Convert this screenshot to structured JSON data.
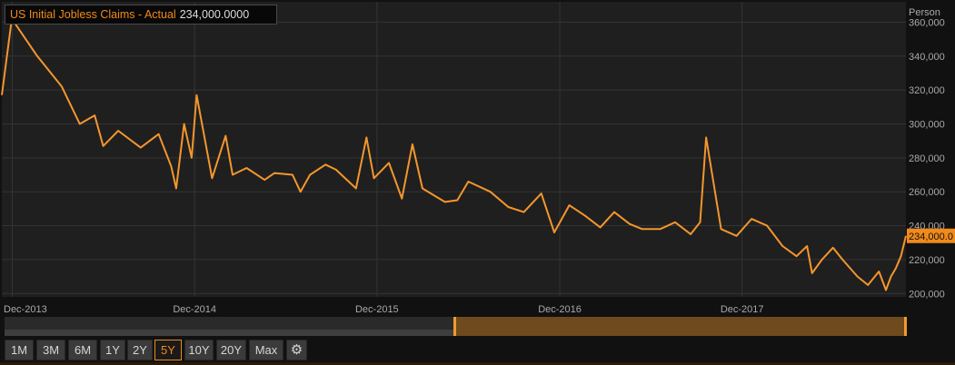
{
  "legend": {
    "series": "US Initial Jobless Claims - Actual",
    "value": "234,000.0000"
  },
  "unit": "Person",
  "colors": {
    "background": "#111111",
    "plot": "#1f1f1f",
    "grid": "#343434",
    "line": "#f4962d",
    "accent": "#f08a1c",
    "tick_text": "#a9a9a9"
  },
  "ranges": {
    "buttons": [
      "1M",
      "3M",
      "6M",
      "1Y",
      "2Y",
      "5Y",
      "10Y",
      "20Y",
      "Max"
    ],
    "active": "5Y",
    "settings_icon": "gear-icon"
  },
  "chart_data": {
    "type": "line",
    "title": "",
    "xlabel": "",
    "ylabel": "Person",
    "ylim": [
      198000,
      372000
    ],
    "xlim": [
      "2013-11-10",
      "2018-10-25"
    ],
    "x_ticks": [
      "Dec-2013",
      "Dec-2014",
      "Dec-2015",
      "Dec-2016",
      "Dec-2017"
    ],
    "x_tick_dates": [
      "2013-12-01",
      "2014-12-01",
      "2015-12-01",
      "2016-12-01",
      "2017-12-01"
    ],
    "y_ticks": [
      200000,
      220000,
      240000,
      260000,
      280000,
      300000,
      320000,
      340000,
      360000
    ],
    "y_tick_labels": [
      "200,000",
      "220,000",
      "240,000",
      "260,000",
      "280,000",
      "300,000",
      "320,000",
      "340,000",
      "360,000"
    ],
    "last_value_label": "234,000.0",
    "grid": true,
    "series": [
      {
        "name": "US Initial Jobless Claims - Actual",
        "x": [
          "2013-11-10",
          "2013-11-30",
          "2014-01-20",
          "2014-03-10",
          "2014-04-15",
          "2014-05-15",
          "2014-06-01",
          "2014-07-01",
          "2014-08-15",
          "2014-09-20",
          "2014-10-15",
          "2014-10-25",
          "2014-11-10",
          "2014-11-25",
          "2014-12-05",
          "2015-01-05",
          "2015-02-01",
          "2015-02-15",
          "2015-03-15",
          "2015-04-20",
          "2015-05-10",
          "2015-06-15",
          "2015-07-01",
          "2015-07-20",
          "2015-08-20",
          "2015-09-10",
          "2015-10-20",
          "2015-11-10",
          "2015-11-25",
          "2015-12-25",
          "2016-01-20",
          "2016-02-10",
          "2016-03-01",
          "2016-04-15",
          "2016-05-10",
          "2016-06-01",
          "2016-07-15",
          "2016-08-20",
          "2016-09-20",
          "2016-10-25",
          "2016-11-20",
          "2016-12-20",
          "2017-01-20",
          "2017-02-20",
          "2017-03-20",
          "2017-04-20",
          "2017-05-15",
          "2017-06-20",
          "2017-07-20",
          "2017-08-20",
          "2017-09-08",
          "2017-09-20",
          "2017-10-20",
          "2017-11-20",
          "2017-12-20",
          "2018-01-20",
          "2018-02-20",
          "2018-03-20",
          "2018-04-10",
          "2018-04-20",
          "2018-05-10",
          "2018-06-01",
          "2018-06-20",
          "2018-07-20",
          "2018-08-10",
          "2018-09-01",
          "2018-09-15",
          "2018-09-25",
          "2018-10-05",
          "2018-10-15",
          "2018-10-25"
        ],
        "values": [
          317000,
          362000,
          340000,
          322000,
          300000,
          305000,
          287000,
          296000,
          286000,
          294000,
          275000,
          262000,
          300000,
          280000,
          317000,
          268000,
          293000,
          270000,
          274000,
          267000,
          271000,
          270000,
          260000,
          270000,
          276000,
          273000,
          262000,
          292000,
          268000,
          277000,
          256000,
          288000,
          262000,
          254000,
          255000,
          266000,
          260000,
          251000,
          248000,
          259000,
          236000,
          252000,
          246000,
          239000,
          248000,
          241000,
          238000,
          238000,
          242000,
          235000,
          242000,
          292000,
          238000,
          234000,
          244000,
          240000,
          228000,
          222000,
          228000,
          212000,
          220000,
          227000,
          220000,
          210000,
          205000,
          213000,
          202000,
          210000,
          215000,
          222000,
          234000
        ]
      }
    ]
  }
}
